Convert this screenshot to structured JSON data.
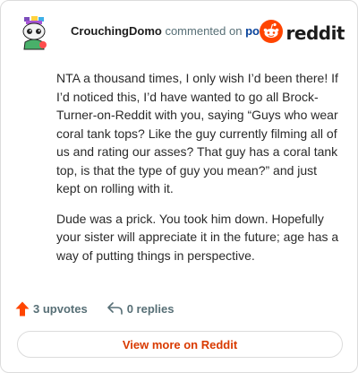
{
  "header": {
    "username": "CrouchingDomo",
    "action_text": "commented on",
    "post_link": "post",
    "brand": "reddit",
    "avatar_icon": "snoo-avatar-icon",
    "logo_icon": "reddit-logo-icon"
  },
  "comment": {
    "paragraphs": [
      "NTA a thousand times, I only wish I’d been there! If I’d noticed this, I’d have wanted to go all Brock-Turner-on-Reddit with you, saying “Guys who wear coral tank tops? Like the guy currently filming all of us and rating our asses? That guy has a coral tank top, is that the type of guy you mean?” and just kept on rolling with it.",
      "Dude was a prick. You took him down. Hopefully your sister will appreciate it in the future; age has a way of putting things in perspective."
    ]
  },
  "actions": {
    "upvotes": "3 upvotes",
    "replies": "0 replies",
    "upvote_icon": "upvote-arrow-icon",
    "reply_icon": "reply-arrow-icon"
  },
  "footer": {
    "view_more": "View more on Reddit"
  },
  "colors": {
    "accent": "#ff4500",
    "link": "#0a449b",
    "muted": "#576f76",
    "view_more_text": "#d93a00"
  }
}
